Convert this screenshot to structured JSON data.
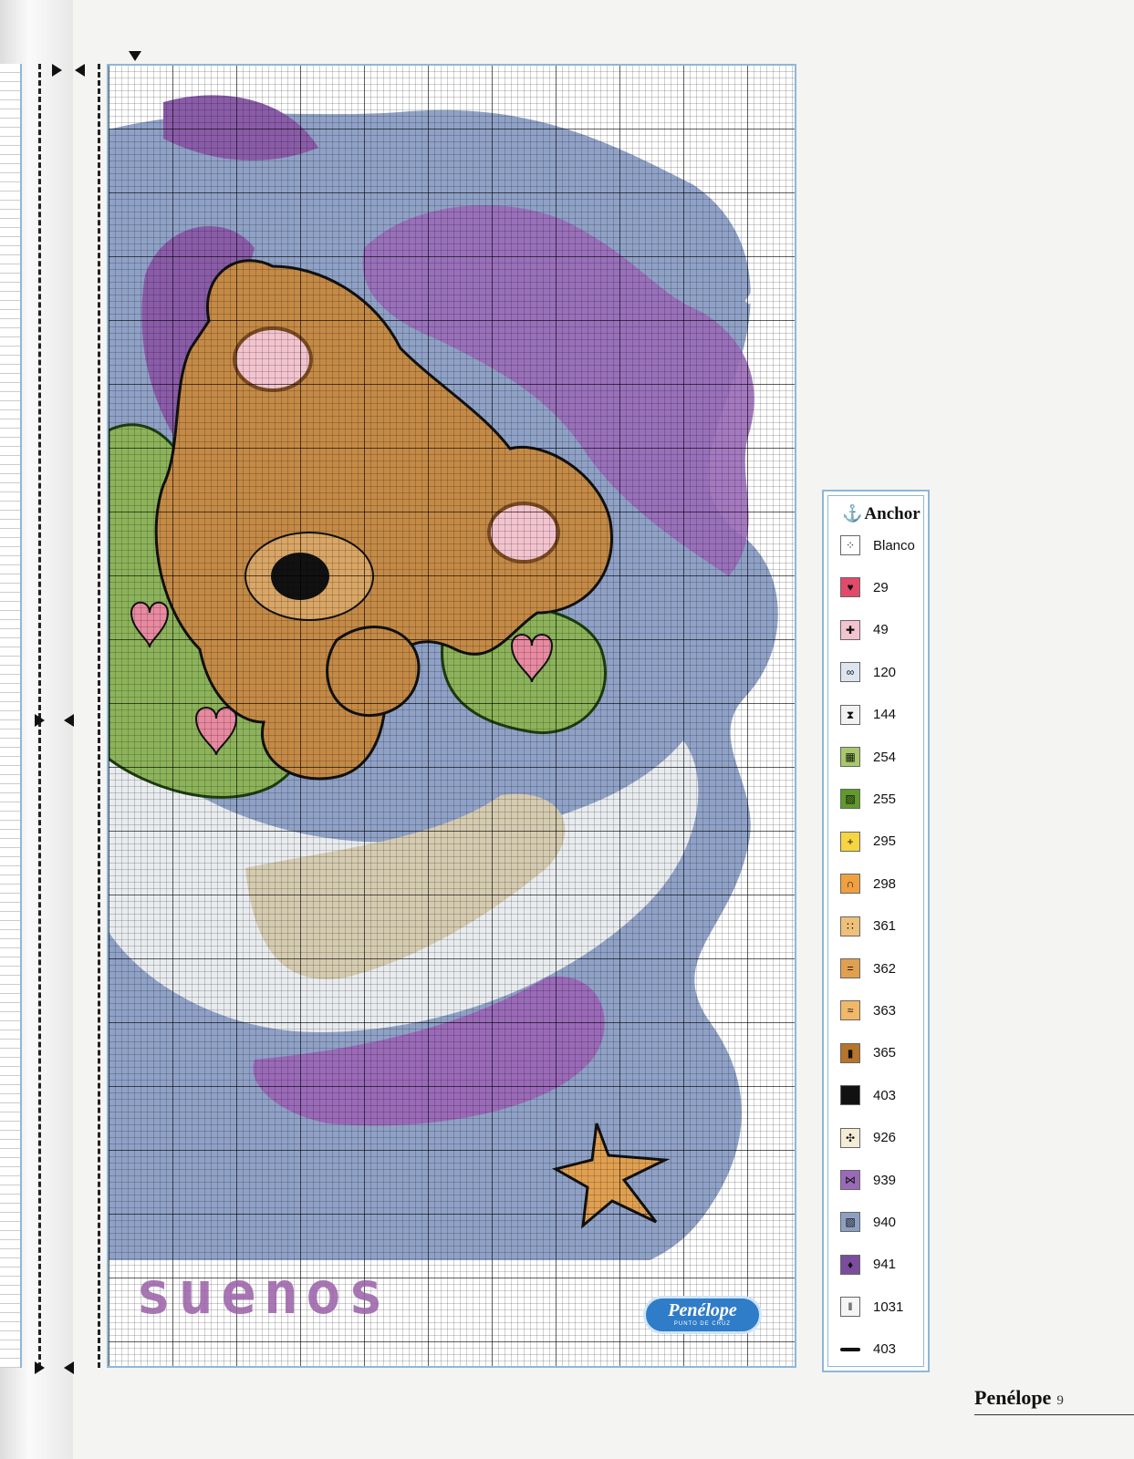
{
  "chart": {
    "word": "suenos"
  },
  "logo": {
    "name": "Penélope",
    "tagline": "PUNTO DE CRUZ"
  },
  "legend": {
    "brand": "Anchor",
    "items": [
      {
        "code": "Blanco",
        "color": "#ffffff",
        "symbol": "⁘"
      },
      {
        "code": "29",
        "color": "#e24a6a",
        "symbol": "♥"
      },
      {
        "code": "49",
        "color": "#f3c4cf",
        "symbol": "✚"
      },
      {
        "code": "120",
        "color": "#dde5ee",
        "symbol": "∞"
      },
      {
        "code": "144",
        "color": "#f2f2f2",
        "symbol": "⧗"
      },
      {
        "code": "254",
        "color": "#a8c86a",
        "symbol": "▦"
      },
      {
        "code": "255",
        "color": "#5f9a2a",
        "symbol": "▨"
      },
      {
        "code": "295",
        "color": "#f6d540",
        "symbol": "+"
      },
      {
        "code": "298",
        "color": "#f0a040",
        "symbol": "∩"
      },
      {
        "code": "361",
        "color": "#efc07a",
        "symbol": "∷"
      },
      {
        "code": "362",
        "color": "#e0a050",
        "symbol": "="
      },
      {
        "code": "363",
        "color": "#f0b868",
        "symbol": "≈"
      },
      {
        "code": "365",
        "color": "#b7742c",
        "symbol": "▮"
      },
      {
        "code": "403",
        "color": "#111111",
        "symbol": ""
      },
      {
        "code": "926",
        "color": "#f3ecd6",
        "symbol": "✣"
      },
      {
        "code": "939",
        "color": "#9a6ab8",
        "symbol": "⋈"
      },
      {
        "code": "940",
        "color": "#8da0c4",
        "symbol": "▧"
      },
      {
        "code": "941",
        "color": "#7b4d9c",
        "symbol": "♦"
      },
      {
        "code": "1031",
        "color": "#f5f5f5",
        "symbol": "‖"
      },
      {
        "code": "403",
        "color": "#111111",
        "symbol": "line"
      }
    ]
  },
  "footer": {
    "brand": "Penélope",
    "page": "9"
  }
}
